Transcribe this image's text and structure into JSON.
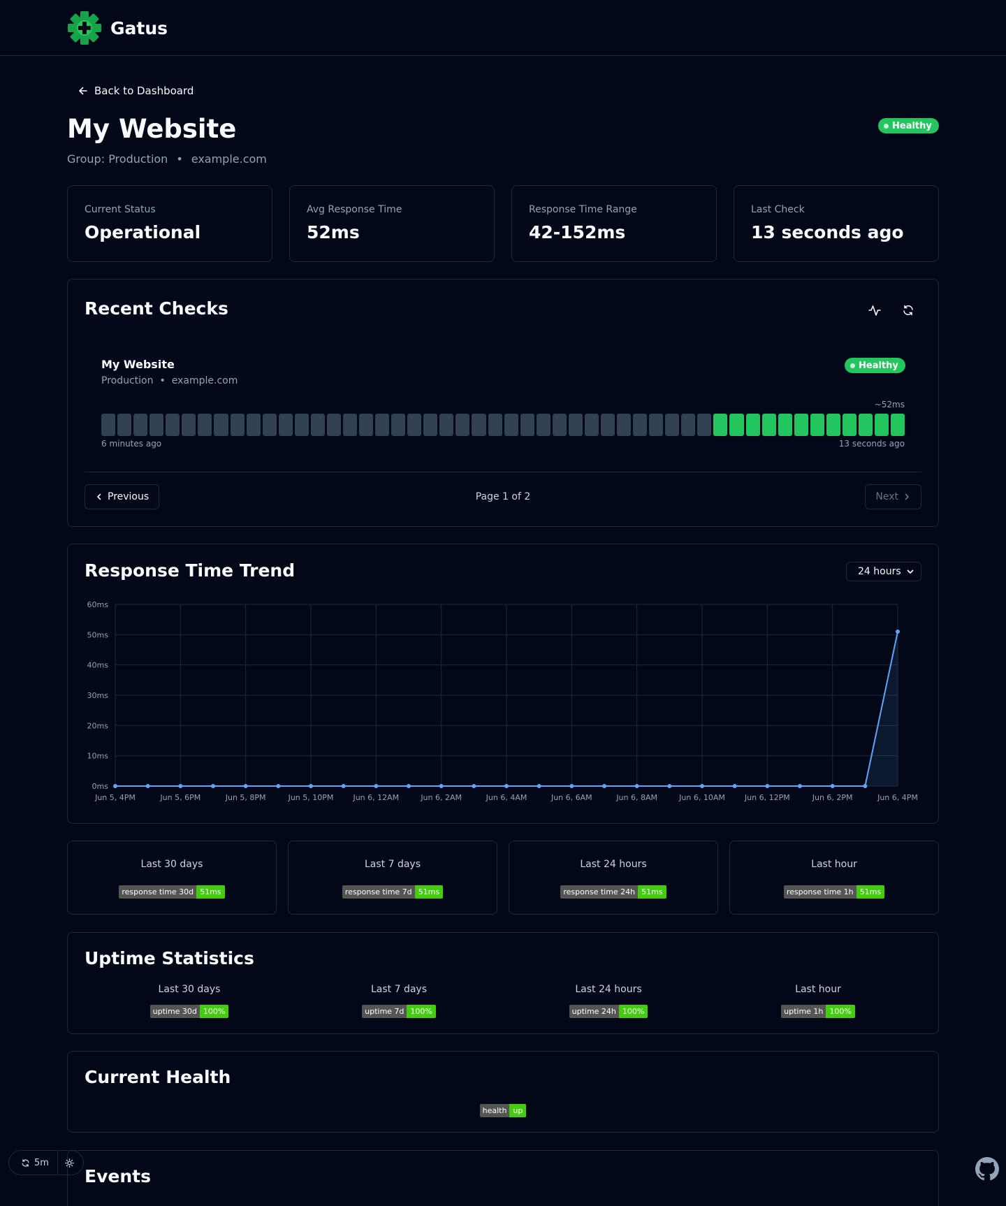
{
  "header": {
    "brand": "Gatus"
  },
  "nav": {
    "back_label": "Back to Dashboard"
  },
  "endpoint": {
    "title": "My Website",
    "group_text": "Group: Production",
    "hostname": "example.com",
    "status_badge": "Healthy"
  },
  "stats": [
    {
      "label": "Current Status",
      "value": "Operational"
    },
    {
      "label": "Avg Response Time",
      "value": "52ms"
    },
    {
      "label": "Response Time Range",
      "value": "42-152ms"
    },
    {
      "label": "Last Check",
      "value": "13 seconds ago"
    }
  ],
  "recent_checks": {
    "title": "Recent Checks",
    "endpoint_name": "My Website",
    "group": "Production",
    "hostname": "example.com",
    "status_badge": "Healthy",
    "avg_label": "~52ms",
    "oldest_label": "6 minutes ago",
    "newest_label": "13 seconds ago",
    "results": [
      "empty",
      "empty",
      "empty",
      "empty",
      "empty",
      "empty",
      "empty",
      "empty",
      "empty",
      "empty",
      "empty",
      "empty",
      "empty",
      "empty",
      "empty",
      "empty",
      "empty",
      "empty",
      "empty",
      "empty",
      "empty",
      "empty",
      "empty",
      "empty",
      "empty",
      "empty",
      "empty",
      "empty",
      "empty",
      "empty",
      "empty",
      "empty",
      "empty",
      "empty",
      "empty",
      "empty",
      "empty",
      "empty",
      "success",
      "success",
      "success",
      "success",
      "success",
      "success",
      "success",
      "success",
      "success",
      "success",
      "success",
      "success"
    ],
    "pagination": {
      "prev_label": "Previous",
      "page_info": "Page 1 of 2",
      "next_label": "Next"
    }
  },
  "trend": {
    "title": "Response Time Trend",
    "range_selected": "24 hours"
  },
  "chart_data": {
    "type": "line",
    "title": "Response Time Trend",
    "x": [
      "Jun 5, 4PM",
      "",
      "Jun 5, 6PM",
      "",
      "Jun 5, 8PM",
      "",
      "Jun 5, 10PM",
      "",
      "Jun 6, 12AM",
      "",
      "Jun 6, 2AM",
      "",
      "Jun 6, 4AM",
      "",
      "Jun 6, 6AM",
      "",
      "Jun 6, 8AM",
      "",
      "Jun 6, 10AM",
      "",
      "Jun 6, 12PM",
      "",
      "Jun 6, 2PM",
      "",
      "Jun 6, 4PM"
    ],
    "series": [
      {
        "values": [
          0,
          0,
          0,
          0,
          0,
          0,
          0,
          0,
          0,
          0,
          0,
          0,
          0,
          0,
          0,
          0,
          0,
          0,
          0,
          0,
          0,
          0,
          0,
          0,
          51
        ]
      }
    ],
    "y_ticks": [
      "0ms",
      "10ms",
      "20ms",
      "30ms",
      "40ms",
      "50ms",
      "60ms"
    ],
    "ylim": [
      0,
      60
    ],
    "grid": true,
    "line_color": "#60a5fa"
  },
  "response_time_cards": [
    {
      "label": "Last 30 days",
      "badge_key": "response time 30d",
      "badge_value": "51ms"
    },
    {
      "label": "Last 7 days",
      "badge_key": "response time 7d",
      "badge_value": "51ms"
    },
    {
      "label": "Last 24 hours",
      "badge_key": "response time 24h",
      "badge_value": "51ms"
    },
    {
      "label": "Last hour",
      "badge_key": "response time 1h",
      "badge_value": "51ms"
    }
  ],
  "uptime": {
    "title": "Uptime Statistics",
    "items": [
      {
        "label": "Last 30 days",
        "badge_key": "uptime 30d",
        "badge_value": "100%"
      },
      {
        "label": "Last 7 days",
        "badge_key": "uptime 7d",
        "badge_value": "100%"
      },
      {
        "label": "Last 24 hours",
        "badge_key": "uptime 24h",
        "badge_value": "100%"
      },
      {
        "label": "Last hour",
        "badge_key": "uptime 1h",
        "badge_value": "100%"
      }
    ]
  },
  "health": {
    "title": "Current Health",
    "badge_key": "health",
    "badge_value": "up"
  },
  "events": {
    "title": "Events"
  },
  "footer": {
    "refresh_interval": "5m"
  },
  "colors": {
    "accent": "#22c55e",
    "background": "#020817",
    "border": "#1e293b",
    "empty_bar": "#334155",
    "badge_green": "#44cc11"
  }
}
